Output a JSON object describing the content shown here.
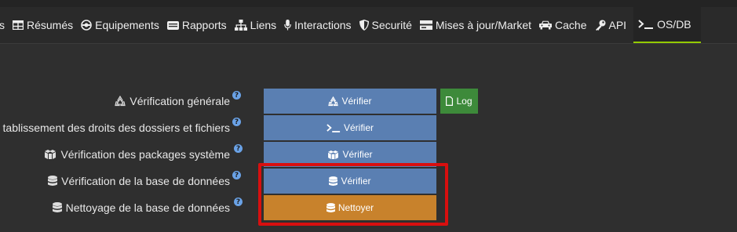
{
  "tabs": [
    {
      "label": "s",
      "icon": "ellipsis"
    },
    {
      "label": "Résumés",
      "icon": "table-icon"
    },
    {
      "label": "Equipements",
      "icon": "devices-icon"
    },
    {
      "label": "Rapports",
      "icon": "report-icon"
    },
    {
      "label": "Liens",
      "icon": "sitemap-icon"
    },
    {
      "label": "Interactions",
      "icon": "microphone-icon"
    },
    {
      "label": "Securité",
      "icon": "shield-icon"
    },
    {
      "label": "Mises à jour/Market",
      "icon": "hdd-icon"
    },
    {
      "label": "Cache",
      "icon": "car-icon"
    },
    {
      "label": "API",
      "icon": "key-icon"
    },
    {
      "label": "OS/DB",
      "icon": "terminal-icon",
      "active": true
    }
  ],
  "rows": [
    {
      "label": "Vérification générale",
      "icon": "recycle-icon",
      "button": "Vérifier",
      "button_icon": "recycle-icon",
      "log": "Log"
    },
    {
      "label": "tablissement des droits des dossiers et fichiers",
      "icon": "",
      "button": "Vérifier",
      "button_icon": "terminal-icon"
    },
    {
      "label": "Vérification des packages système",
      "icon": "cubes-icon",
      "button": "Vérifier",
      "button_icon": "cubes-icon"
    },
    {
      "label": "Vérification de la base de données",
      "icon": "database-icon",
      "button": "Vérifier",
      "button_icon": "database-icon"
    },
    {
      "label": "Nettoyage de la base de données",
      "icon": "database-icon",
      "button": "Nettoyer",
      "button_icon": "database-icon"
    }
  ],
  "colors": {
    "accent": "#94ca02",
    "button_blue": "#5a7fb2",
    "button_orange": "#c8822c",
    "button_green": "#3d8a3a",
    "highlight_red": "#d80f0f"
  }
}
